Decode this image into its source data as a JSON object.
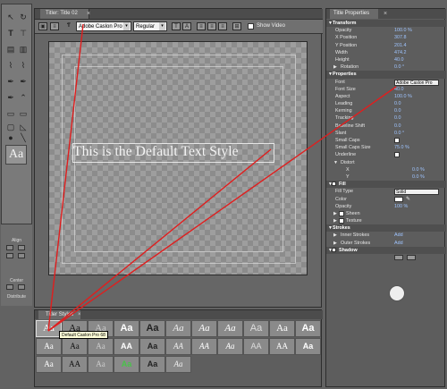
{
  "titler": {
    "tab_label": "Titler: Title 02",
    "font_select": "Adobe Caslon Pro",
    "style_select": "Regular",
    "show_video_label": "Show Video",
    "canvas_text": "This is the Default Text Style"
  },
  "tools": {
    "aa_label": "Aa",
    "align_label": "Align",
    "center_label": "Center",
    "distribute_label": "Distribute"
  },
  "styles_panel": {
    "tab_label": "Titler Styles",
    "tooltip": "Default Caslon Pro 68",
    "swatches": [
      "Aa",
      "Aa",
      "Aa",
      "Aa",
      "Aa",
      "Aa",
      "Aa",
      "Aa",
      "Aa",
      "Aa",
      "Aa",
      "Aa",
      "Aa",
      "Aa",
      "AA",
      "Aa",
      "AA",
      "AA",
      "Aa",
      "AA",
      "AA",
      "Aa",
      "Aa",
      "AA",
      "Aa",
      "Aa",
      "Aa",
      "Aa"
    ]
  },
  "properties": {
    "tab_label": "Title Properties",
    "transform_header": "Transform",
    "opacity_label": "Opacity",
    "opacity_value": "100.0 %",
    "xpos_label": "X Position",
    "xpos_value": "307.8",
    "ypos_label": "Y Position",
    "ypos_value": "201.4",
    "width_label": "Width",
    "width_value": "474.2",
    "height_label": "Height",
    "height_value": "40.0",
    "rotation_label": "Rotation",
    "rotation_value": "0.0 °",
    "properties_header": "Properties",
    "font_label": "Font",
    "font_value": "Adobe Caslon Pro",
    "fontsize_label": "Font Size",
    "fontsize_value": "40.0",
    "aspect_label": "Aspect",
    "aspect_value": "100.0 %",
    "leading_label": "Leading",
    "leading_value": "0.0",
    "kerning_label": "Kerning",
    "kerning_value": "0.0",
    "tracking_label": "Tracking",
    "tracking_value": "0.0",
    "baseline_label": "Baseline Shift",
    "baseline_value": "0.0",
    "slant_label": "Slant",
    "slant_value": "0.0 °",
    "smallcaps_label": "Small Caps",
    "smallcapssize_label": "Small Caps Size",
    "smallcapssize_value": "75.0 %",
    "underline_label": "Underline",
    "distort_label": "Distort",
    "dx_label": "X",
    "dx_value": "0.0 %",
    "dy_label": "Y",
    "dy_value": "0.0 %",
    "fill_header": "Fill",
    "filltype_label": "Fill Type",
    "filltype_value": "Solid",
    "color_label": "Color",
    "fillopacity_label": "Opacity",
    "fillopacity_value": "100 %",
    "sheen_label": "Sheen",
    "texture_label": "Texture",
    "strokes_header": "Strokes",
    "inner_label": "Inner Strokes",
    "inner_value": "Add",
    "outer_label": "Outer Strokes",
    "outer_value": "Add",
    "shadow_header": "Shadow"
  },
  "colors": {
    "annotation_line": "#e01e1e",
    "link_text": "#9ec4ff"
  }
}
